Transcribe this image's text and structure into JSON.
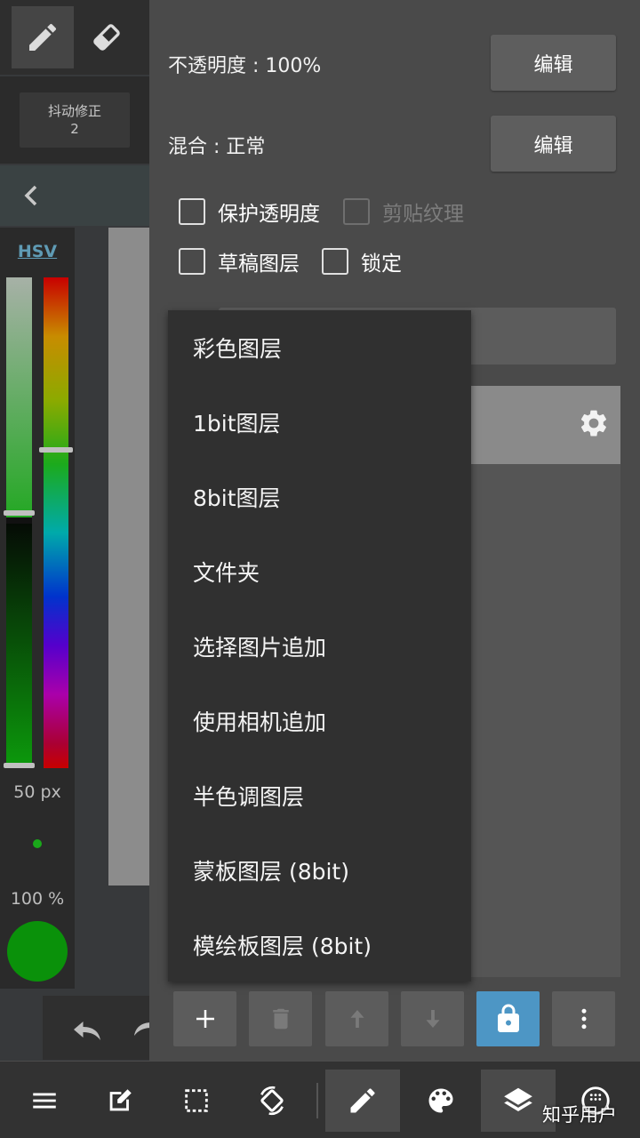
{
  "toolbar": {
    "stabilizer_label": "抖动修正",
    "stabilizer_value": "2"
  },
  "color_panel": {
    "mode_label": "HSV",
    "brush_size": "50 px",
    "brush_opacity": "100 %",
    "current_color": "#0a910a"
  },
  "layer_props": {
    "opacity_label": "不透明度 : 100%",
    "blend_label": "混合 : 正常",
    "edit_label": "编辑",
    "protect_alpha": "保护透明度",
    "clipping": "剪贴纹理",
    "draft_layer": "草稿图层",
    "lock": "锁定"
  },
  "add_layer_menu": {
    "items": [
      "彩色图层",
      "1bit图层",
      "8bit图层",
      "文件夹",
      "选择图片追加",
      "使用相机追加",
      "半色调图层",
      "蒙板图层 (8bit)",
      "模绘板图层 (8bit)"
    ]
  },
  "icons": {
    "pen": "pen-icon",
    "eraser": "eraser-icon",
    "collapse": "chevron-left-icon",
    "gear": "gear-icon",
    "add": "plus-icon",
    "delete": "trash-icon",
    "move_up": "arrow-up-icon",
    "move_down": "arrow-down-icon",
    "lock": "lock-icon",
    "more": "more-vert-icon",
    "menu": "hamburger-icon",
    "edit": "edit-icon",
    "select": "selection-icon",
    "rotate": "rotate-icon",
    "palette": "palette-icon",
    "layers": "layers-icon"
  },
  "colors": {
    "accent_lock": "#4d96c5",
    "hsv_link": "#5f9bb5"
  },
  "watermark": "知乎用户"
}
